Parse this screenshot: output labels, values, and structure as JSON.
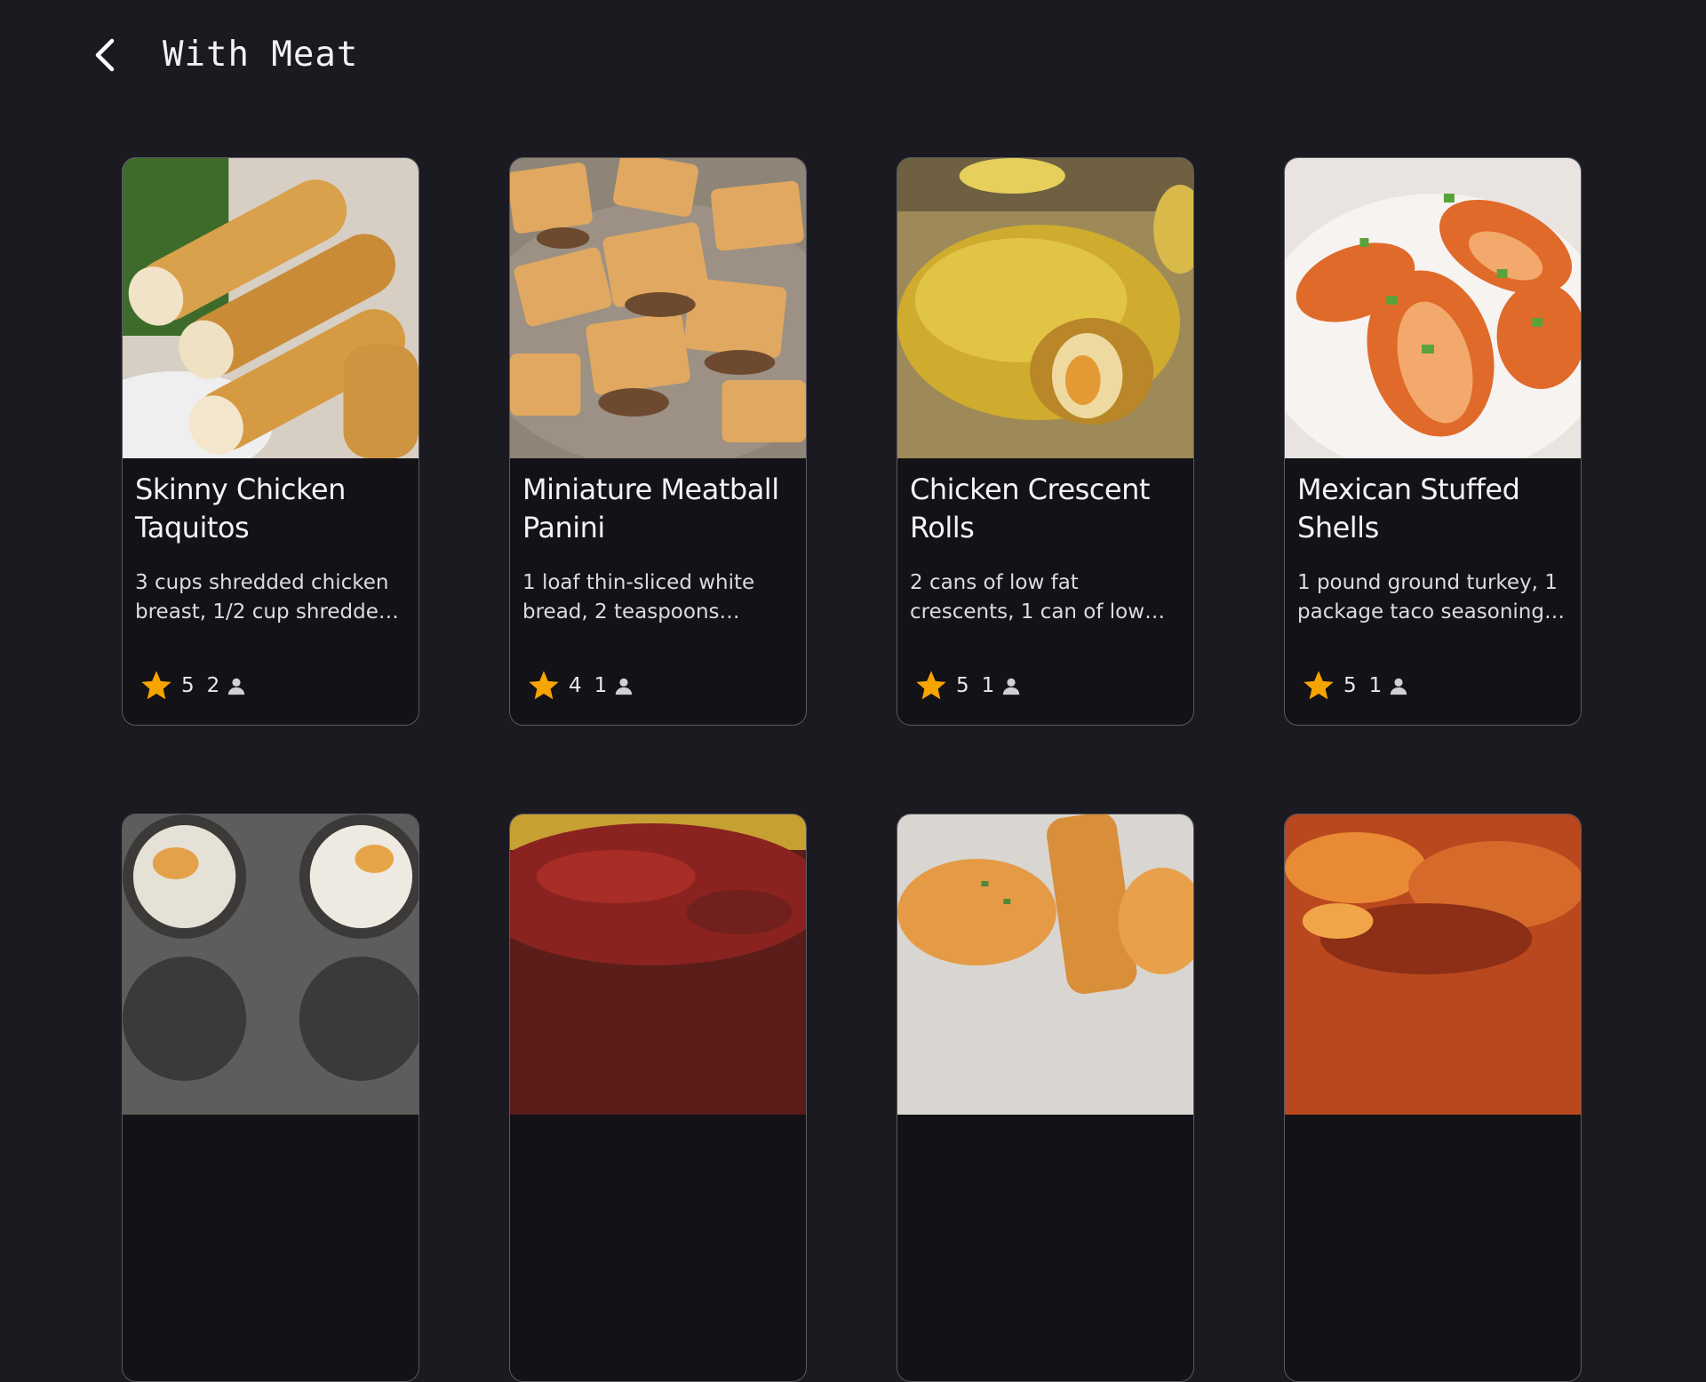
{
  "header": {
    "title": "With Meat"
  },
  "colors": {
    "background": "#1b1a21",
    "card_background": "#121217",
    "star": "#f6a400"
  },
  "icons": {
    "back": "chevron-left-icon",
    "rating": "star-icon",
    "reviewers": "person-icon"
  },
  "recipes": [
    {
      "title": "Skinny Chicken Taquitos",
      "description": "3 cups shredded chicken breast, 1/2 cup shredded ...",
      "rating": "5",
      "reviews": "2"
    },
    {
      "title": "Miniature Meatball Panini",
      "description": "1 loaf thin-sliced white bread, 2 teaspoons extra-...",
      "rating": "4",
      "reviews": "1"
    },
    {
      "title": "Chicken Crescent Rolls",
      "description": "2 cans of low fat crescents, 1 can of low sodium crea...",
      "rating": "5",
      "reviews": "1"
    },
    {
      "title": "Mexican Stuffed Shells",
      "description": "1 pound ground turkey, 1 package taco seasoning, 4...",
      "rating": "5",
      "reviews": "1"
    }
  ]
}
